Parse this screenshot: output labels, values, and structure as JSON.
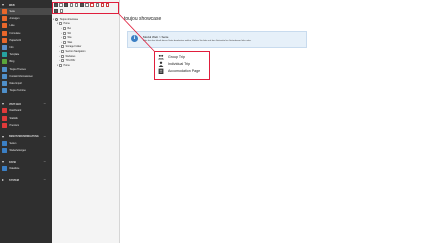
{
  "sidebar": {
    "group_web": "Web",
    "group_verwaltung": "Benutzerverwaltung",
    "group_system": "System",
    "group_visit": "Visit Geo",
    "group_datei": "Datei",
    "items": [
      {
        "label": "Seite",
        "color": "#e9672b",
        "active": true
      },
      {
        "label": "Anzeigen",
        "color": "#e9672b"
      },
      {
        "label": "Liste",
        "color": "#e9672b"
      },
      {
        "label": "Formulare",
        "color": "#e9672b"
      },
      {
        "label": "Papierkorb",
        "color": "#e9672b"
      },
      {
        "label": "Info",
        "color": "#5b8fc9"
      },
      {
        "label": "Template",
        "color": "#27a2a0"
      },
      {
        "label": "Blog",
        "color": "#5aa53b"
      },
      {
        "label": "Toujou Themes",
        "color": "#4f8fc9"
      },
      {
        "label": "Kontakt Informationen",
        "color": "#4f8fc9"
      },
      {
        "label": "Data Import",
        "color": "#4f8fc9"
      },
      {
        "label": "Toujou Termine",
        "color": "#4f8fc9"
      }
    ],
    "visit_items": [
      {
        "label": "Dashboard",
        "color": "#e03a3a"
      },
      {
        "label": "Statistik",
        "color": "#e03a3a"
      },
      {
        "label": "Premium",
        "color": "#e03a3a"
      }
    ],
    "verwaltung_items": [
      {
        "label": "Seiten",
        "color": "#3b7fc4"
      },
      {
        "label": "Weiterleitungen",
        "color": "#3b7fc4"
      }
    ],
    "datei_items": [
      {
        "label": "Dateiliste",
        "color": "#3b7fc4"
      }
    ]
  },
  "tree": {
    "root": "Toujou showcase",
    "nodes": [
      "Home",
      "Bei",
      "Wir",
      "Wie",
      "Was",
      "Storage Folder",
      "Section Navigation",
      "Websites",
      "TOUJOU",
      "Home"
    ]
  },
  "main": {
    "title": "toujou showcase",
    "info_title": "Modul Web > Seite",
    "info_text": "Bitte bei den Inhalt dieser Seite bearbeiten wollen, klicken Sie bitte auf den Seitentitel im Seitenbaum links oder."
  },
  "popup": {
    "items": [
      {
        "label": "Group Trip",
        "icon": "group-icon"
      },
      {
        "label": "Individual Trip",
        "icon": "person-icon"
      },
      {
        "label": "Accomodation Page",
        "icon": "building-icon"
      }
    ]
  },
  "colors": {
    "highlight": "#e01e3c",
    "sidebar_bg": "#2f2f2f",
    "info_bg": "#e6f0f9"
  }
}
